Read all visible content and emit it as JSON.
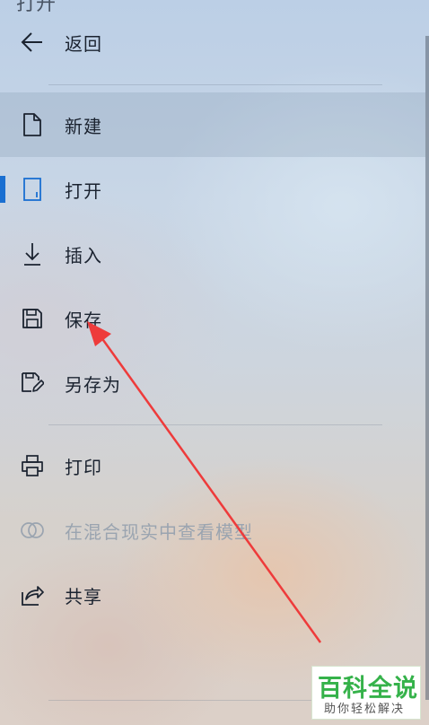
{
  "partial_title": "打开",
  "back": {
    "label": "返回",
    "icon": "back-arrow-icon"
  },
  "menu": {
    "new": {
      "label": "新建",
      "icon": "document-icon"
    },
    "open": {
      "label": "打开",
      "icon": "open-file-icon"
    },
    "insert": {
      "label": "插入",
      "icon": "download-arrow-icon"
    },
    "save": {
      "label": "保存",
      "icon": "save-icon"
    },
    "save_as": {
      "label": "另存为",
      "icon": "save-as-icon"
    },
    "print": {
      "label": "打印",
      "icon": "printer-icon"
    },
    "mixed_reality": {
      "label": "在混合现实中查看模型",
      "icon": "mixed-reality-icon"
    },
    "share": {
      "label": "共享",
      "icon": "share-icon"
    }
  },
  "watermark": {
    "main": "百科全说",
    "sub": "助你轻松解决"
  },
  "colors": {
    "accent": "#1a6fd1",
    "annotation_arrow": "#ee3b3b",
    "disabled_text": "#9aa4b0",
    "watermark_green": "#35b24a"
  }
}
